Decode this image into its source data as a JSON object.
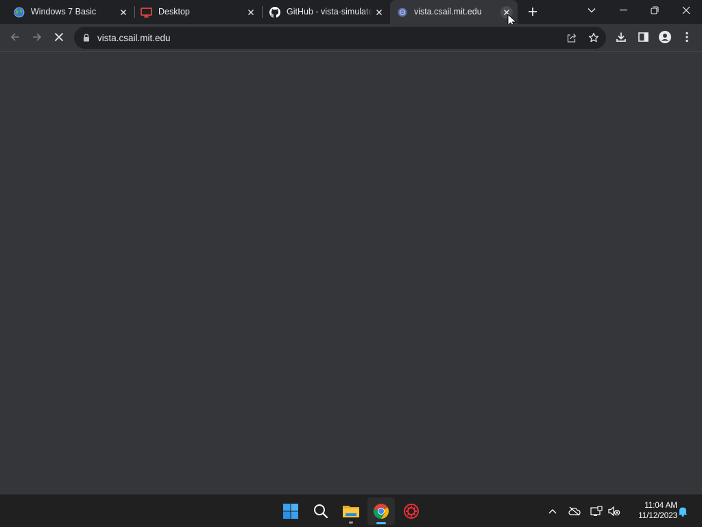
{
  "browser": {
    "tabs": [
      {
        "title": "Windows 7 Basic",
        "favicon": "globe-icon",
        "active": false
      },
      {
        "title": "Desktop",
        "favicon": "monitor-icon",
        "active": false
      },
      {
        "title": "GitHub - vista-simulator",
        "favicon": "github-icon",
        "active": false
      },
      {
        "title": "vista.csail.mit.edu",
        "favicon": "loading-globe-icon",
        "active": true
      }
    ],
    "address_bar": {
      "url": "vista.csail.mit.edu"
    },
    "icons": {
      "back": "back-arrow-icon",
      "forward": "forward-arrow-icon",
      "stop": "stop-loading-icon",
      "share": "share-icon",
      "bookmark": "star-icon",
      "download": "download-icon",
      "side_panel": "side-panel-icon",
      "profile": "profile-icon",
      "menu": "kebab-menu-icon"
    }
  },
  "taskbar": {
    "apps": [
      {
        "name": "start-button",
        "icon": "windows-logo-icon"
      },
      {
        "name": "search-button",
        "icon": "search-icon"
      },
      {
        "name": "file-explorer-app",
        "icon": "folder-icon"
      },
      {
        "name": "chrome-app",
        "icon": "chrome-icon"
      },
      {
        "name": "red-gear-app",
        "icon": "red-gear-icon"
      }
    ],
    "clock": {
      "time": "11:04 AM",
      "date": "11/12/2023"
    }
  },
  "colors": {
    "tabstrip": "#202124",
    "toolbar": "#35363a",
    "omnibox": "#202124",
    "taskbar": "#202020",
    "accent": "#4cc2ff"
  }
}
